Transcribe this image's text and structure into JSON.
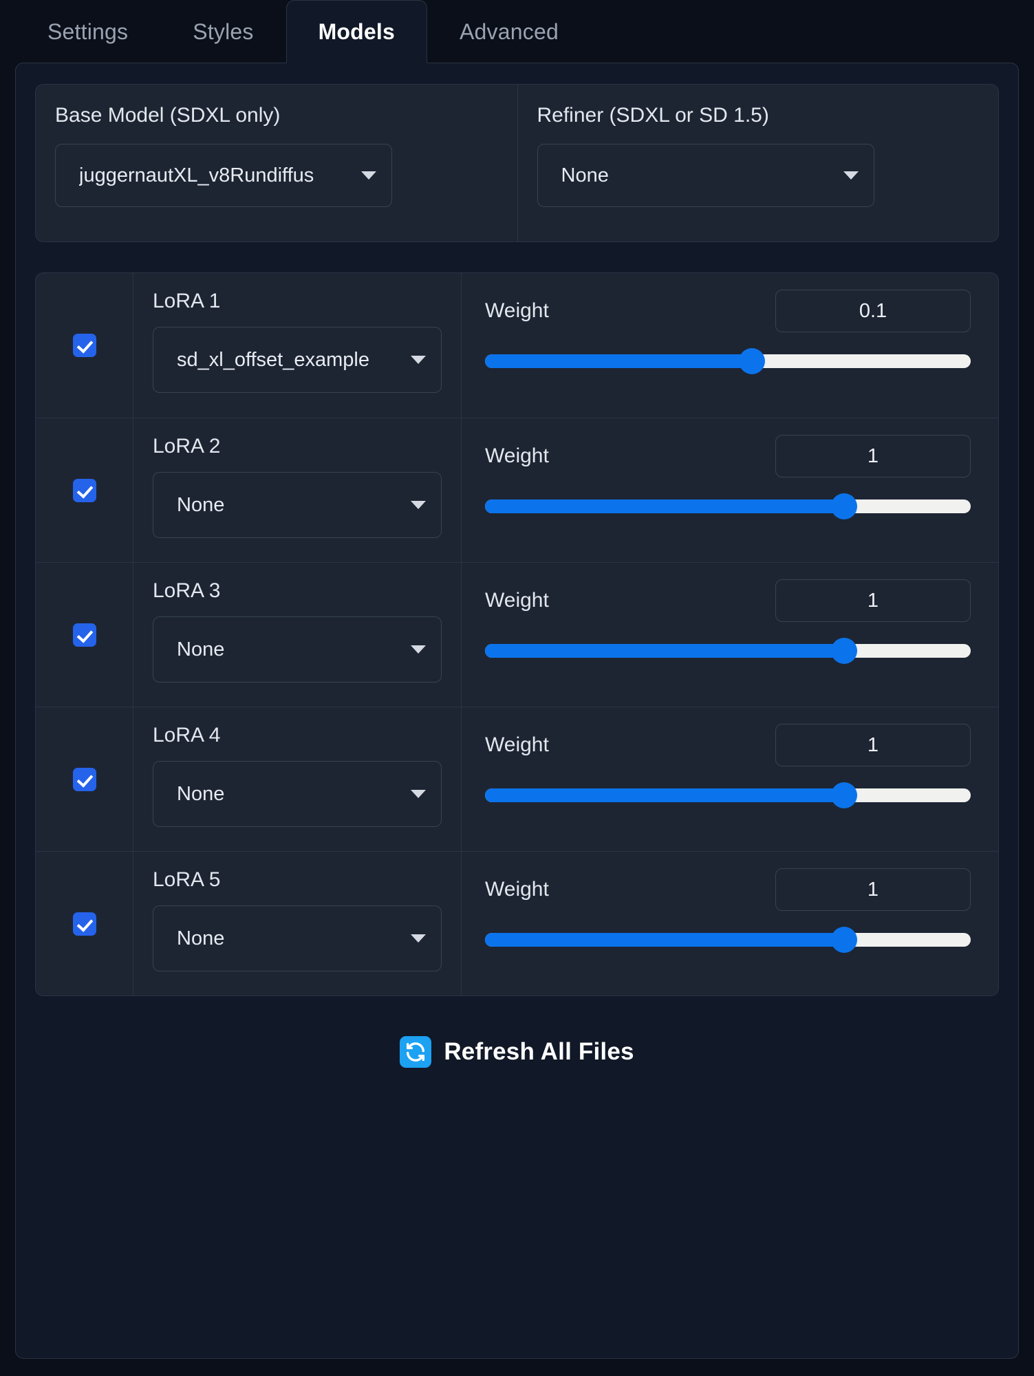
{
  "tabs": [
    {
      "label": "Settings",
      "active": false
    },
    {
      "label": "Styles",
      "active": false
    },
    {
      "label": "Models",
      "active": true
    },
    {
      "label": "Advanced",
      "active": false
    }
  ],
  "models": {
    "base": {
      "label": "Base Model (SDXL only)",
      "value": "juggernautXL_v8Rundiffus",
      "caret_icon": "chevron-down-icon"
    },
    "refiner": {
      "label": "Refiner (SDXL or SD 1.5)",
      "value": "None",
      "caret_icon": "chevron-down-icon"
    }
  },
  "lora": {
    "weight_label": "Weight",
    "rows": [
      {
        "title": "LoRA 1",
        "enabled": true,
        "model": "sd_xl_offset_example",
        "weight": "0.1",
        "slider_percent": 55
      },
      {
        "title": "LoRA 2",
        "enabled": true,
        "model": "None",
        "weight": "1",
        "slider_percent": 74
      },
      {
        "title": "LoRA 3",
        "enabled": true,
        "model": "None",
        "weight": "1",
        "slider_percent": 74
      },
      {
        "title": "LoRA 4",
        "enabled": true,
        "model": "None",
        "weight": "1",
        "slider_percent": 74
      },
      {
        "title": "LoRA 5",
        "enabled": true,
        "model": "None",
        "weight": "1",
        "slider_percent": 74
      }
    ]
  },
  "footer": {
    "refresh_label": "Refresh All Files",
    "refresh_icon": "refresh-icon"
  },
  "colors": {
    "accent_blue": "#0b74ec",
    "checkbox_blue": "#2563eb",
    "refresh_icon_blue": "#1da1f2",
    "panel_bg": "#111827",
    "card_bg": "#1d2533",
    "page_bg": "#0b0f19",
    "border": "#2b3445"
  }
}
